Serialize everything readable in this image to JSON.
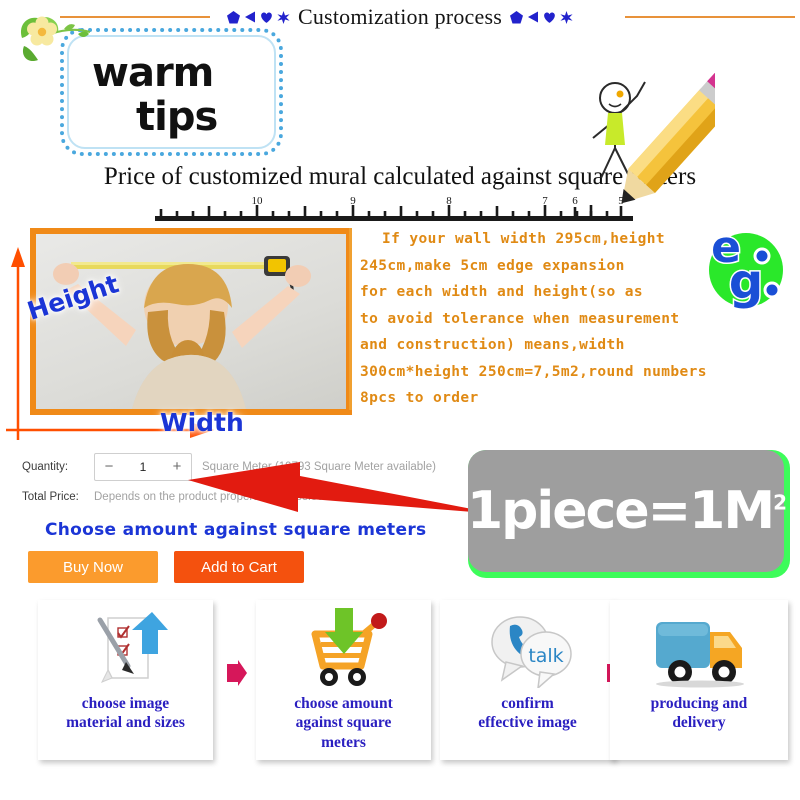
{
  "header": {
    "title": "Customization process",
    "decoration_left": [
      "pentagon",
      "triangle",
      "heart",
      "four-point-star"
    ],
    "decoration_right": [
      "pentagon",
      "triangle",
      "heart",
      "four-point-star"
    ],
    "rule_color": "#e8923a"
  },
  "tips_box": {
    "line1": "warm",
    "line2": "tips",
    "border_color": "#4aa8de"
  },
  "price_heading": "Price of customized mural calculated against square meters",
  "ruler": {
    "labels": [
      "10",
      "9",
      "8",
      "7",
      "6",
      "5"
    ]
  },
  "photo": {
    "height_label": "Height",
    "width_label": "Width",
    "frame_color": "#f08a18",
    "label_color": "#1b35d6"
  },
  "description": {
    "color": "#e08a14",
    "lines": [
      "If your wall width 295cm,height",
      "245cm,make 5cm edge expansion",
      "for each width and height(so as",
      "to avoid tolerance when measurement",
      "and construction) means,width",
      "300cm*height 250cm=7,5m2,round numbers",
      "8pcs to order"
    ]
  },
  "eg_badge": {
    "letter_e": "e",
    "letter_g": "g",
    "dot1": ".",
    "dot2": ".",
    "circle_color": "#2ae82a",
    "text_color": "#1a4fd6"
  },
  "order_form": {
    "quantity_label": "Quantity:",
    "minus": "−",
    "quantity_value": "1",
    "plus": "+",
    "unit_text": "Square Meter (19793 Square Meter available)",
    "total_price_label": "Total Price:",
    "total_price_value": "Depends on the product properties you select",
    "choose_note": "Choose amount against square meters",
    "buy_now": "Buy Now",
    "add_to_cart": "Add to Cart",
    "buy_color": "#fb9b2d",
    "cart_color": "#f4510e"
  },
  "piece_badge": {
    "text": "1piece=1M",
    "superscript": "2",
    "plate_color": "#9e9e9e",
    "glow_color": "#3dfc5a"
  },
  "steps": [
    {
      "icon": "document-checklist-icon",
      "caption": "choose image\nmaterial and sizes"
    },
    {
      "icon": "shopping-cart-download-icon",
      "caption": "choose amount\nagainst square\nmeters"
    },
    {
      "icon": "talk-bubbles-icon",
      "caption": "confirm\neffective image"
    },
    {
      "icon": "delivery-truck-icon",
      "caption": "producing and\ndelivery"
    }
  ],
  "step_arrow_color": "#d6175a"
}
